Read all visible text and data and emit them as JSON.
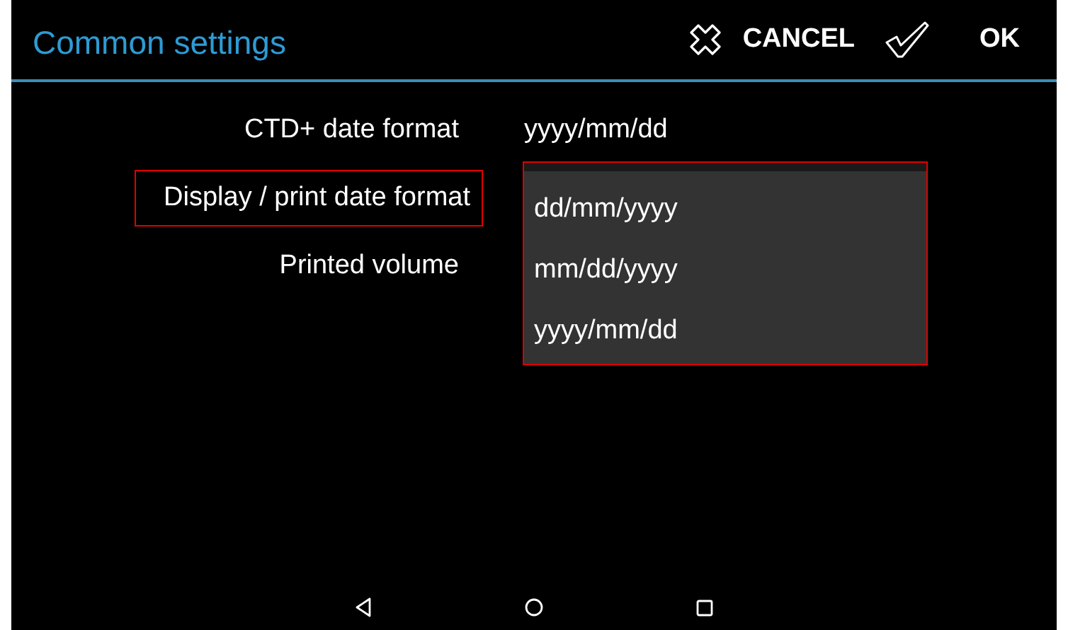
{
  "header": {
    "title": "Common settings",
    "actions": [
      {
        "kind": "cancel",
        "label": "CANCEL"
      },
      {
        "kind": "ok",
        "label": "OK"
      }
    ]
  },
  "settings": [
    {
      "label": "CTD+ date format",
      "value": "yyyy/mm/dd",
      "highlighted": false
    },
    {
      "label": "Display / print date format",
      "highlighted": true
    },
    {
      "label": "Printed volume",
      "highlighted": false
    }
  ],
  "dropdown": {
    "highlighted": true,
    "options": [
      "dd/mm/yyyy",
      "mm/dd/yyyy",
      "yyyy/mm/dd"
    ]
  },
  "nav_bar": [
    {
      "kind": "back"
    },
    {
      "kind": "home"
    },
    {
      "kind": "recents"
    }
  ]
}
